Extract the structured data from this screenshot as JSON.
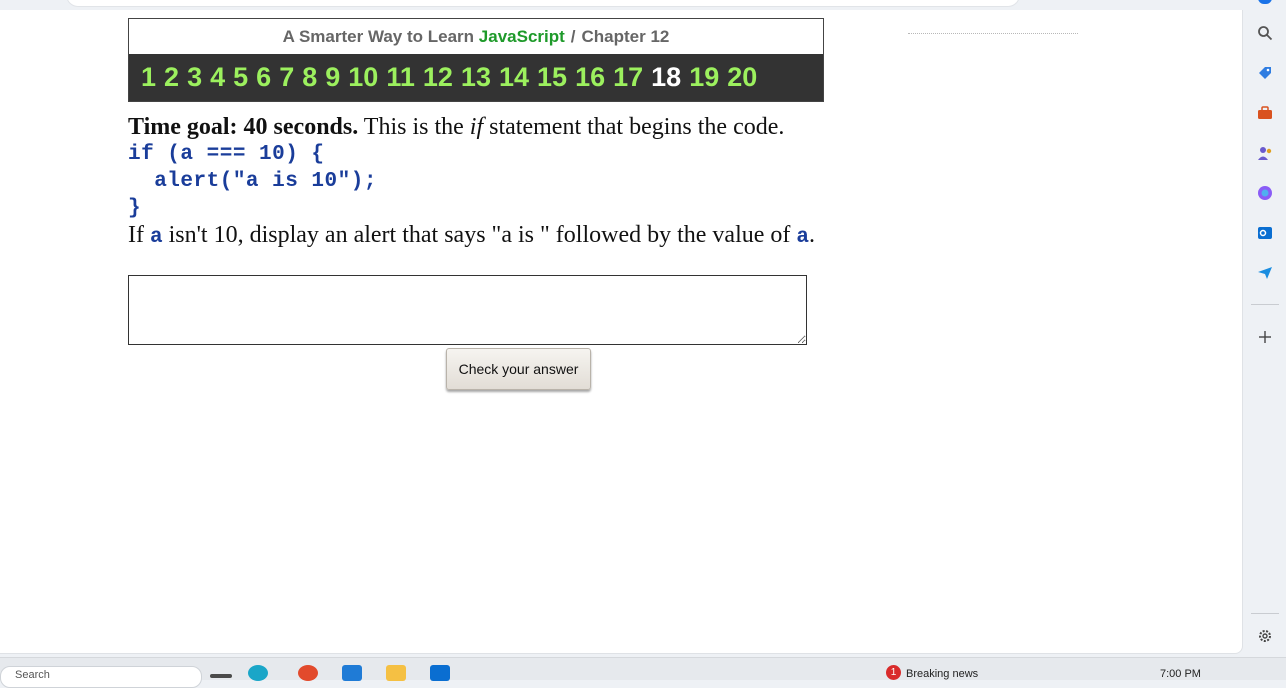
{
  "header": {
    "title_prefix": "A Smarter Way to Learn ",
    "title_highlight": "JavaScript",
    "title_sep": "/",
    "title_chapter": "Chapter 12"
  },
  "chapter_nav": [
    "1",
    "2",
    "3",
    "4",
    "5",
    "6",
    "7",
    "8",
    "9",
    "10",
    "11",
    "12",
    "13",
    "14",
    "15",
    "16",
    "17",
    "18",
    "19",
    "20"
  ],
  "current_exercise": "18",
  "exercise": {
    "goal_label": "Time goal: 40 seconds.",
    "intro_pre": " This is the ",
    "intro_em": "if",
    "intro_post": " statement that begins the code.",
    "code_line1": "if (a === 10) {",
    "code_line2": "  alert(\"a is 10\");",
    "code_line3": "}",
    "task_pre": "If ",
    "task_var1": "a",
    "task_mid": " isn't 10, display an alert that says \"a is \" followed by the value of ",
    "task_var2": "a",
    "task_post": "."
  },
  "answer_value": "",
  "check_button": "Check your answer",
  "sidebar_icons": [
    "search-icon",
    "tag-icon",
    "briefcase-icon",
    "people-icon",
    "copilot-icon",
    "outlook-icon",
    "send-icon",
    "plus-icon",
    "gear-icon"
  ],
  "taskbar": {
    "search_placeholder": "Search",
    "news_badge": "1",
    "news_label": "Breaking news",
    "clock": "7:00 PM"
  }
}
